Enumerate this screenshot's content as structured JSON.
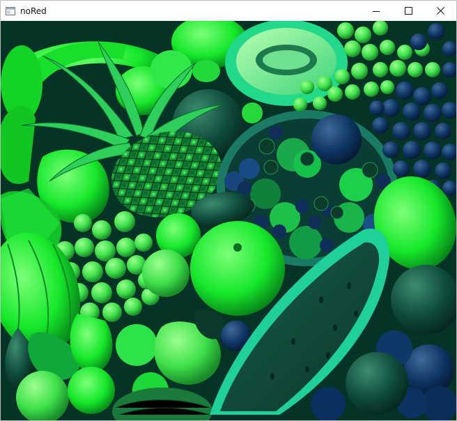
{
  "window": {
    "title": "noRed",
    "icon": "app-window-icon",
    "controls": {
      "minimize": "minimize-icon",
      "maximize": "maximize-icon",
      "close": "close-icon"
    }
  },
  "image": {
    "subject": "assorted fruit",
    "tint": "green-cyan"
  },
  "colors": {
    "bright_green": "#1bff2f",
    "deep_teal": "#063a2a",
    "cyan_green": "#19c98a",
    "navy_blue": "#0b2a52"
  }
}
